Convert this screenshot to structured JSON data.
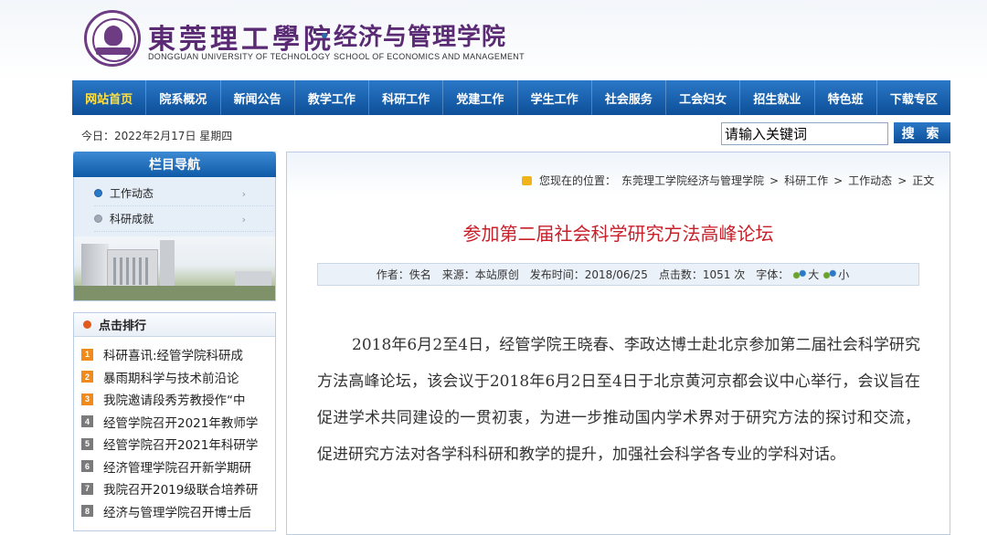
{
  "header": {
    "school_cn": "東莞理工學院",
    "school_en": "DONGGUAN UNIVERSITY OF TECHNOLOGY",
    "college_cn": "经济与管理学院",
    "college_en": "SCHOOL OF ECONOMICS AND MANAGEMENT"
  },
  "nav": {
    "items": [
      "网站首页",
      "院系概况",
      "新闻公告",
      "教学工作",
      "科研工作",
      "党建工作",
      "学生工作",
      "社会服务",
      "工会妇女",
      "招生就业",
      "特色班",
      "下载专区"
    ],
    "active_index": 0
  },
  "date_text": "今日：2022年2月17日 星期四",
  "search": {
    "value": "请输入关键词",
    "button": "搜 索"
  },
  "sidebar": {
    "column_title": "栏目导航",
    "items": [
      {
        "label": "工作动态",
        "active": true
      },
      {
        "label": "科研成就",
        "active": false
      }
    ],
    "rank_title": "点击排行",
    "rank_items": [
      {
        "num": "1",
        "text": "科研喜讯:经管学院科研成"
      },
      {
        "num": "2",
        "text": "暴雨期科学与技术前沿论"
      },
      {
        "num": "3",
        "text": "我院邀请段秀芳教授作“中"
      },
      {
        "num": "4",
        "text": "经管学院召开2021年教师学"
      },
      {
        "num": "5",
        "text": "经管学院召开2021年科研学"
      },
      {
        "num": "6",
        "text": "经济管理学院召开新学期研"
      },
      {
        "num": "7",
        "text": "我院召开2019级联合培养研"
      },
      {
        "num": "8",
        "text": "经济与管理学院召开博士后"
      }
    ]
  },
  "breadcrumb": {
    "prefix": "您现在的位置：",
    "items": [
      "东莞理工学院经济与管理学院",
      "科研工作",
      "工作动态",
      "正文"
    ],
    "separator": ">"
  },
  "article": {
    "title": "参加第二届社会科学研究方法高峰论坛",
    "author": "作者：佚名",
    "source": "来源：本站原创",
    "time": "发布时间：2018/06/25",
    "clicks": "点击数：1051  次",
    "font_label": "字体：",
    "font_big": "大",
    "font_small": "小",
    "body": "2018年6月2至4日，经管学院王晓春、李政达博士赴北京参加第二届社会科学研究方法高峰论坛，该会议于2018年6月2日至4日于北京黄河京都会议中心举行，会议旨在促进学术共同建设的一贯初衷，为进一步推动国内学术界对于研究方法的探讨和交流，促进研究方法对各学科科研和教学的提升，加强社会科学各专业的学科对话。"
  }
}
